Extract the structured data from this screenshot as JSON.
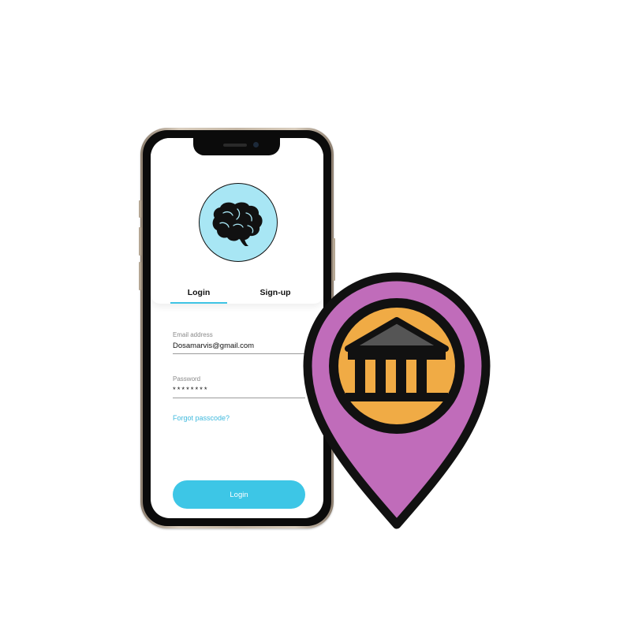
{
  "tabs": {
    "login_label": "Login",
    "signup_label": "Sign-up"
  },
  "form": {
    "email_label": "Email address",
    "email_value": "Dosamarvis@gmail.com",
    "password_label": "Password",
    "password_value": "********",
    "forgot_label": "Forgot passcode?",
    "submit_label": "Login"
  },
  "icons": {
    "logo": "brain-icon",
    "pin": "map-pin-icon",
    "pin_inner": "bank-building-icon"
  },
  "colors": {
    "accent": "#3dc6e6",
    "logo_background": "#a8e6f4",
    "pin_fill": "#c06cba",
    "pin_inner_fill": "#f0ab45",
    "bank_roof": "#555555"
  }
}
